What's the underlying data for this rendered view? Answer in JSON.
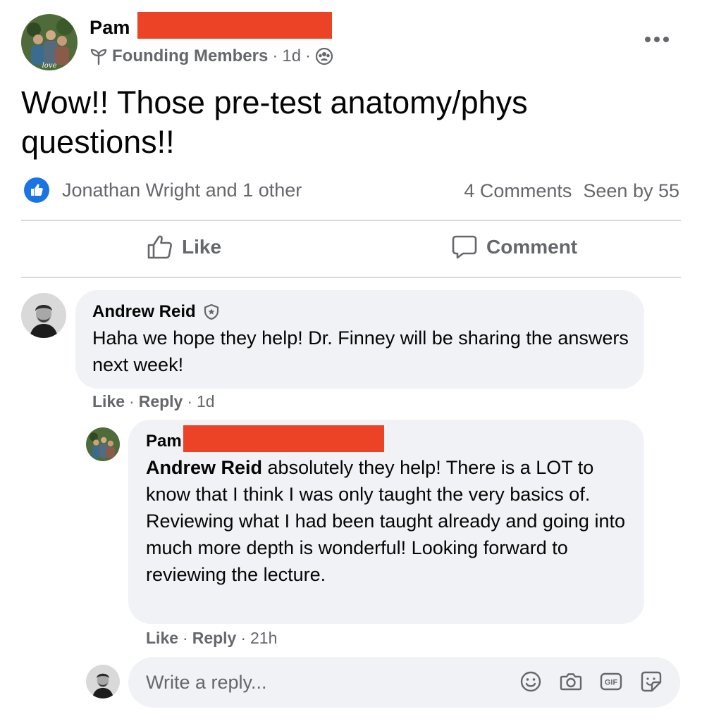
{
  "post": {
    "author_name": "Pam",
    "group_badge": "Founding Members",
    "time": "1d",
    "text": "Wow!! Those pre-test anatomy/phys questions!!",
    "avatar_label": "love",
    "reactions_text": "Jonathan Wright and 1 other",
    "comments_count": "4 Comments",
    "seen_by": "Seen by 55"
  },
  "actions": {
    "like_label": "Like",
    "comment_label": "Comment"
  },
  "comments": [
    {
      "author": "Andrew Reid",
      "text": "Haha we hope they help! Dr. Finney will be sharing the answers next week!",
      "like_label": "Like",
      "reply_label": "Reply",
      "time": "1d"
    },
    {
      "author": "Pam",
      "mention": "Andrew Reid",
      "text": " absolutely they help! There is a LOT to know that I think I was only taught the very basics of. Reviewing what I had been taught already and going into much more depth is wonderful! Looking forward to reviewing the lecture.",
      "like_label": "Like",
      "reply_label": "Reply",
      "time": "21h"
    }
  ],
  "reply_box": {
    "placeholder": "Write a reply..."
  },
  "icons": {
    "more": "more-horizontal-icon",
    "badge": "sprout-icon",
    "audience": "group-icon",
    "like_reaction": "like-reaction-icon",
    "thumbs_up": "thumbs-up-icon",
    "comment": "comment-bubble-icon",
    "admin": "admin-shield-icon",
    "emoji": "emoji-icon",
    "camera": "camera-icon",
    "gif": "gif-icon",
    "sticker": "sticker-icon"
  },
  "colors": {
    "redaction": "#ec4326",
    "like_blue": "#1b74e4",
    "secondary_text": "#65676b",
    "bubble_bg": "#f0f2f5"
  }
}
